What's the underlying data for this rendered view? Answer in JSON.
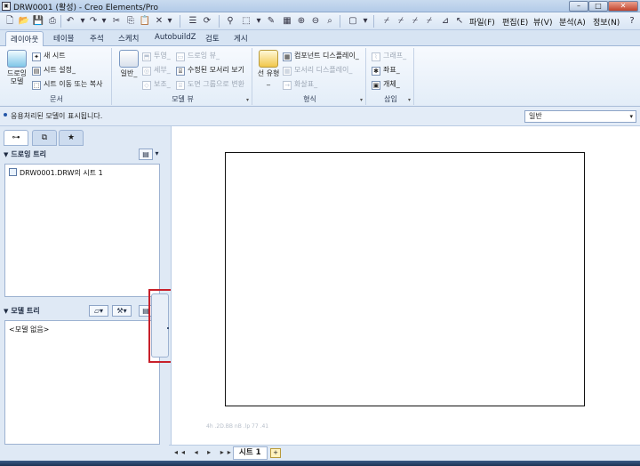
{
  "window": {
    "title": "DRW0001 (활성) - Creo Elements/Pro",
    "app_icon": "creo-icon"
  },
  "menu": [
    "파일(F)",
    "편집(E)",
    "뷰(V)",
    "분석(A)",
    "정보(N)"
  ],
  "tabs": [
    "레이아웃",
    "테이블",
    "주석",
    "스케치",
    "AutobuildZ",
    "검토",
    "게시"
  ],
  "active_tab": "레이아웃",
  "ribbon": {
    "group_doc": {
      "label": "문서",
      "big": "드로잉 모델",
      "items": [
        "새 시트",
        "시트 설정_",
        "시트 이동 또는 복사"
      ]
    },
    "group_model_view": {
      "label": "모델 뷰",
      "big": "일반_",
      "items_col1": [
        "투영_",
        "세부_",
        "보조_"
      ],
      "items_col2": [
        "드로잉 뷰_",
        "수정된 모서리 보기",
        "도면 그룹으로 변환"
      ]
    },
    "group_format": {
      "label": "형식",
      "big": "선 유형_",
      "items": [
        "컴포넌트 디스플레이_",
        "모서리 디스플레이_",
        "화살표_"
      ]
    },
    "group_insert": {
      "label": "삽입",
      "items": [
        "그래프_",
        "좌표_",
        "개체_"
      ]
    }
  },
  "message": "응용처리된 모델이 표시됩니다.",
  "filter": {
    "value": "일반"
  },
  "drawing_tree": {
    "title": "드로잉 트리",
    "items": [
      "DRW0001.DRW의 시트 1"
    ]
  },
  "model_tree": {
    "title": "모델 트리",
    "empty": "<모델 없음>"
  },
  "sheet_tab": {
    "label": "시트 1"
  },
  "faint_text": "4h .2D.BB nB .lp 77 .41",
  "colors": {
    "accent": "#2457a8",
    "highlight": "#c8202a"
  }
}
